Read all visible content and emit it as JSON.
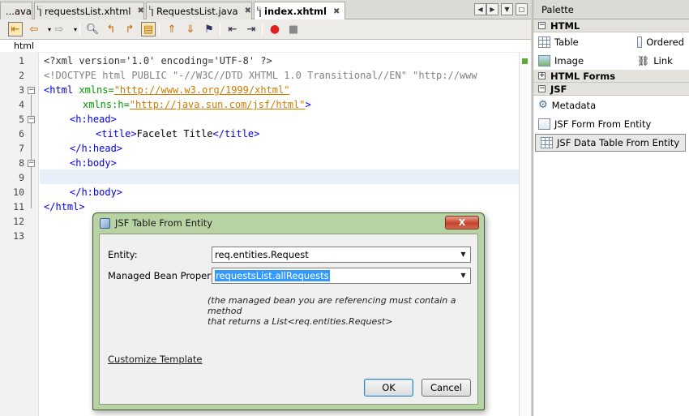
{
  "tabs": [
    {
      "label": "...ava",
      "active": false
    },
    {
      "label": "requestsList.xhtml",
      "active": false
    },
    {
      "label": "RequestsList.java",
      "active": false
    },
    {
      "label": "index.xhtml",
      "active": true
    }
  ],
  "editor": {
    "breadcrumb": "html",
    "line_numbers": [
      "1",
      "2",
      "3",
      "4",
      "5",
      "6",
      "7",
      "8",
      "9",
      "10",
      "11",
      "12",
      "13"
    ],
    "lines": {
      "l1": "<?xml version='1.0' encoding='UTF-8' ?>",
      "l2": "<!DOCTYPE html PUBLIC \"-//W3C//DTD XHTML 1.0 Transitional//EN\" \"http://www",
      "l3_tag_open": "<html",
      "l3_attr": " xmlns=",
      "l3_val": "\"http://www.w3.org/1999/xhtml\"",
      "l4_attr": "xmlns:h=",
      "l4_val": "\"http://java.sun.com/jsf/html\"",
      "l4_end": ">",
      "l5": "<h:head>",
      "l6_open": "<title>",
      "l6_text": "Facelet Title",
      "l6_close": "</title>",
      "l7": "</h:head>",
      "l8": "<h:body>",
      "l10": "</h:body>",
      "l11": "</html>"
    }
  },
  "palette": {
    "title": "Palette",
    "categories": {
      "html": "HTML",
      "html_forms": "HTML Forms",
      "jsf": "JSF"
    },
    "html_items": {
      "table": "Table",
      "ordered": "Ordered",
      "image": "Image",
      "link": "Link"
    },
    "jsf_items": {
      "metadata": "Metadata",
      "form_from_entity": "JSF Form From Entity",
      "data_table_from_entity": "JSF Data Table From Entity"
    }
  },
  "dialog": {
    "title": "JSF Table From Entity",
    "close_label": "X",
    "entity_label": "Entity:",
    "entity_value": "req.entities.Request",
    "bean_label": "Managed Bean Property:",
    "bean_value": "requestsList.allRequests",
    "hint_line1": "(the managed bean you are referencing must contain a method",
    "hint_line2": "that returns a List<req.entities.Request>",
    "customize_link": "Customize Template",
    "ok_label": "OK",
    "cancel_label": "Cancel"
  }
}
